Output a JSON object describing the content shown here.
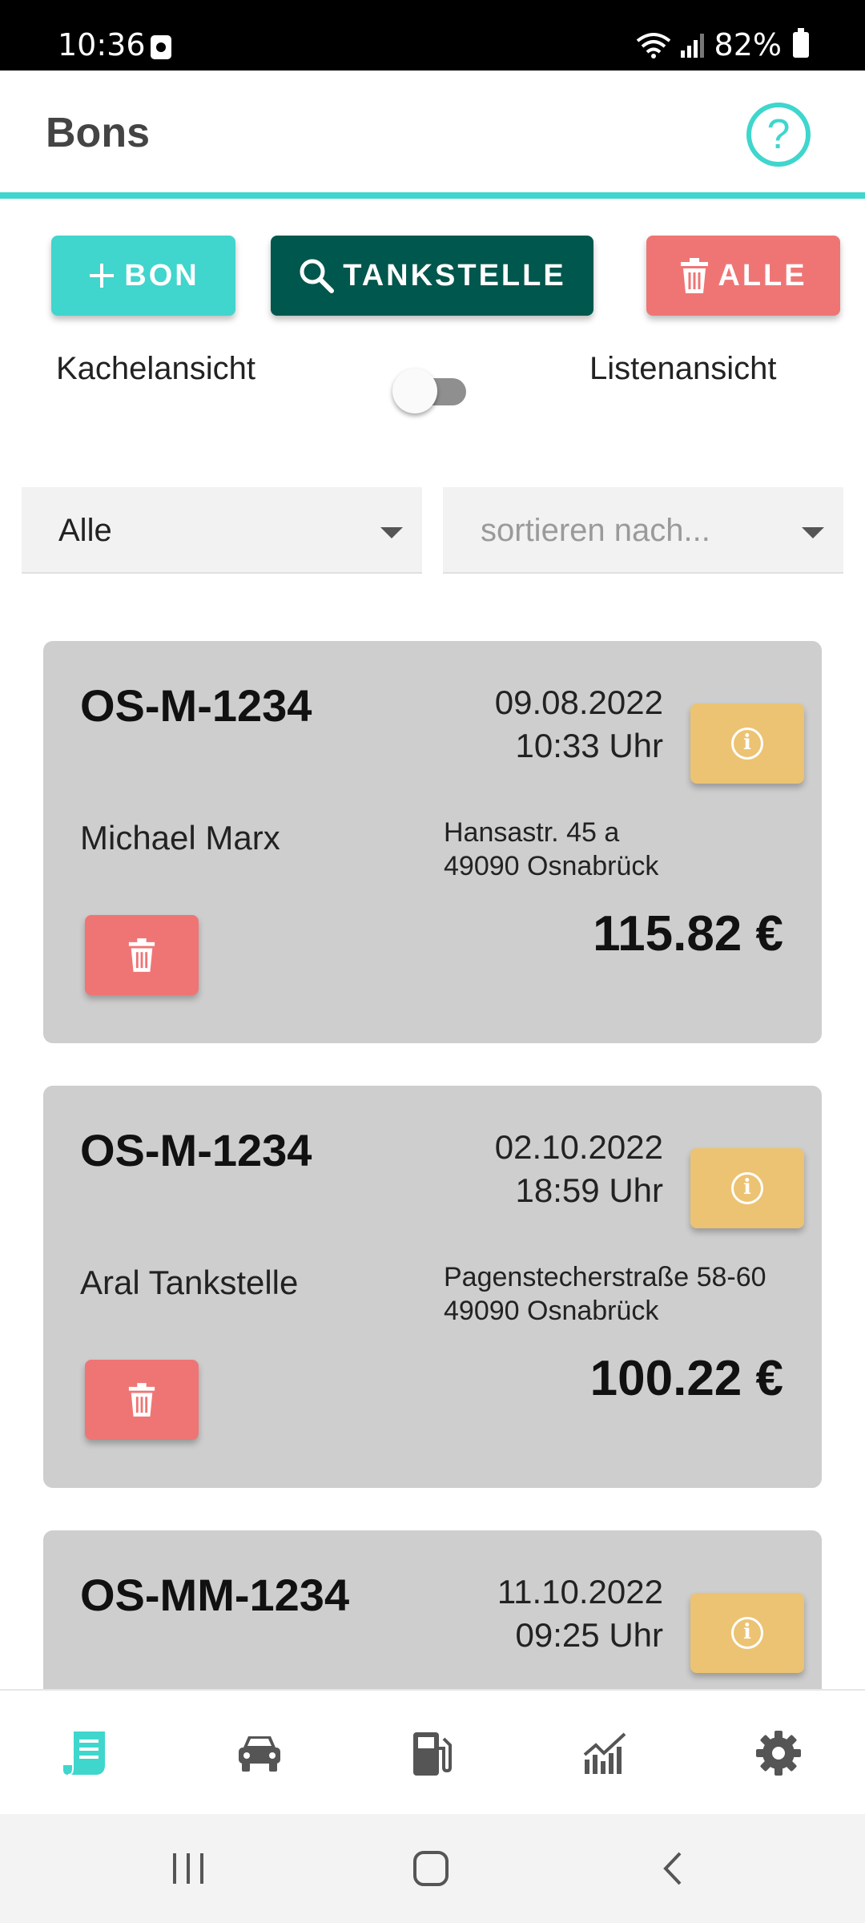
{
  "status_bar": {
    "time": "10:36",
    "battery": "82%"
  },
  "header": {
    "title": "Bons",
    "help_symbol": "?"
  },
  "toolbar": {
    "add_label": "BON",
    "search_label": "TANKSTELLE",
    "delete_all_label": "ALLE"
  },
  "view_toggle": {
    "left_label": "Kachelansicht",
    "right_label": "Listenansicht",
    "state": "off"
  },
  "filters": {
    "vehicle_value": "Alle",
    "sort_placeholder": "sortieren nach..."
  },
  "receipts": [
    {
      "plate": "OS-M-1234",
      "date": "09.08.2022",
      "time": "10:33 Uhr",
      "name": "Michael Marx",
      "street": "Hansastr. 45 a",
      "city": "49090 Osnabrück",
      "amount": "115.82 €"
    },
    {
      "plate": "OS-M-1234",
      "date": "02.10.2022",
      "time": "18:59 Uhr",
      "name": "Aral Tankstelle",
      "street": "Pagenstecherstraße 58-60",
      "city": "49090 Osnabrück",
      "amount": "100.22 €"
    },
    {
      "plate": "OS-MM-1234",
      "date": "11.10.2022",
      "time": "09:25 Uhr",
      "name": "",
      "street": "",
      "city": "",
      "amount": ""
    }
  ],
  "bottom_nav": [
    {
      "icon": "receipt-icon",
      "active": true
    },
    {
      "icon": "car-icon",
      "active": false
    },
    {
      "icon": "fuel-pump-icon",
      "active": false
    },
    {
      "icon": "statistics-icon",
      "active": false
    },
    {
      "icon": "gear-icon",
      "active": false
    }
  ],
  "colors": {
    "accent": "#3ed6cd",
    "primary_dark": "#00574d",
    "danger": "#ef7575",
    "info": "#ecc373",
    "card": "#cecece"
  }
}
